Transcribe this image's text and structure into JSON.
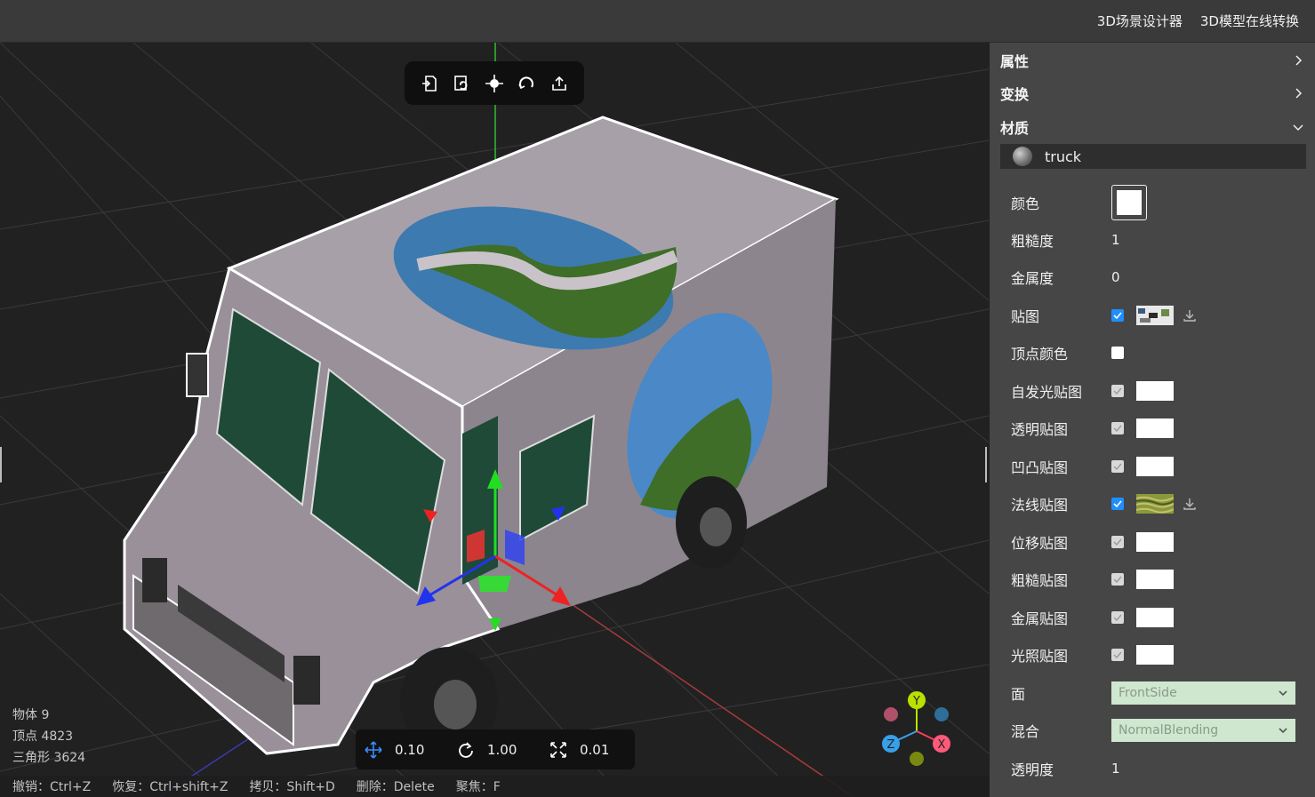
{
  "header": {
    "links": [
      "3D场景设计器",
      "3D模型在线转换"
    ]
  },
  "toolbar": {
    "icons": [
      "import-icon",
      "replace-icon",
      "focus-target-icon",
      "reset-view-icon",
      "export-icon"
    ]
  },
  "stats": {
    "objects": "物体 9",
    "vertices": "顶点 4823",
    "triangles": "三角形 3624"
  },
  "transform_bar": {
    "move": "0.10",
    "rotate": "1.00",
    "scale": "0.01"
  },
  "shortcuts": [
    "撤销：Ctrl+Z",
    "恢复：Ctrl+shift+Z",
    "拷贝：Shift+D",
    "删除：Delete",
    "聚焦：F"
  ],
  "panel": {
    "sections": {
      "attributes": "属性",
      "transform": "变换",
      "material": "材质"
    },
    "material_name": "truck",
    "color_label": "颜色",
    "color_value": "#ffffff",
    "roughness_label": "粗糙度",
    "roughness_value": "1",
    "metalness_label": "金属度",
    "metalness_value": "0",
    "map_label": "贴图",
    "vertex_color_label": "顶点颜色",
    "emissive_map_label": "自发光贴图",
    "alpha_map_label": "透明贴图",
    "bump_map_label": "凹凸贴图",
    "normal_map_label": "法线贴图",
    "displacement_map_label": "位移贴图",
    "roughness_map_label": "粗糙贴图",
    "metal_map_label": "金属贴图",
    "light_map_label": "光照贴图",
    "side_label": "面",
    "side_value": "FrontSide",
    "blending_label": "混合",
    "blending_value": "NormalBlending",
    "opacity_label": "透明度",
    "opacity_value": "1"
  },
  "colors": {
    "checkbox_on": "#1f8fff",
    "axis_x": "#ff3b5c",
    "axis_y": "#b8e000",
    "axis_z": "#38a0e8"
  }
}
